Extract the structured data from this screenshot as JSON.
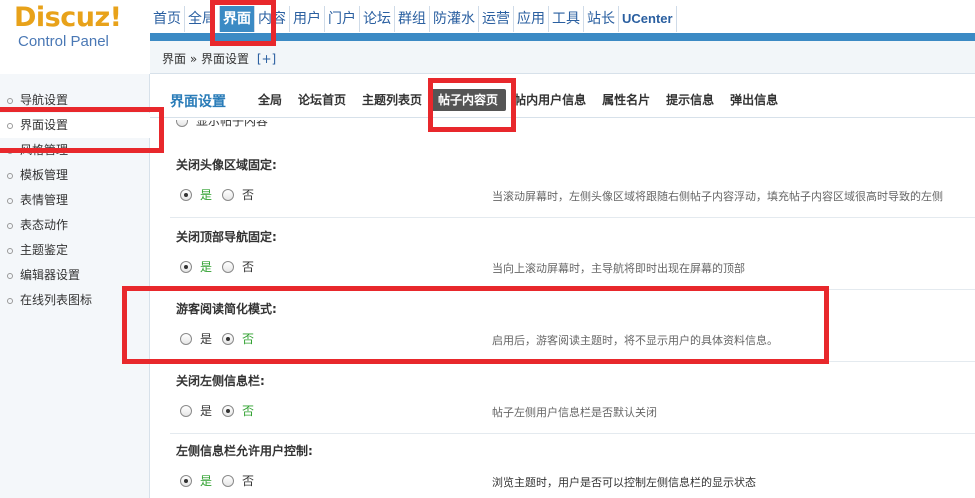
{
  "logo": {
    "brand": "Discuz!",
    "subtitle": "Control Panel"
  },
  "topnav": {
    "items": [
      {
        "label": "首页",
        "active": false
      },
      {
        "label": "全局",
        "active": false
      },
      {
        "label": "界面",
        "active": true
      },
      {
        "label": "内容",
        "active": false
      },
      {
        "label": "用户",
        "active": false
      },
      {
        "label": "门户",
        "active": false
      },
      {
        "label": "论坛",
        "active": false
      },
      {
        "label": "群组",
        "active": false
      },
      {
        "label": "防灌水",
        "active": false
      },
      {
        "label": "运营",
        "active": false
      },
      {
        "label": "应用",
        "active": false
      },
      {
        "label": "工具",
        "active": false
      },
      {
        "label": "站长",
        "active": false
      },
      {
        "label": "UCenter",
        "active": false
      }
    ]
  },
  "breadcrumb": {
    "text": "界面 » 界面设置",
    "add": "[+]"
  },
  "sidebar": {
    "items": [
      {
        "label": "导航设置"
      },
      {
        "label": "界面设置"
      },
      {
        "label": "风格管理"
      },
      {
        "label": "模板管理"
      },
      {
        "label": "表情管理"
      },
      {
        "label": "表态动作"
      },
      {
        "label": "主题鉴定"
      },
      {
        "label": "编辑器设置"
      },
      {
        "label": "在线列表图标"
      }
    ],
    "active_index": 1
  },
  "subnav": {
    "title": "界面设置",
    "tabs": [
      {
        "label": "全局"
      },
      {
        "label": "论坛首页"
      },
      {
        "label": "主题列表页"
      },
      {
        "label": "帖子内容页"
      },
      {
        "label": "帖内用户信息"
      },
      {
        "label": "属性名片"
      },
      {
        "label": "提示信息"
      },
      {
        "label": "弹出信息"
      }
    ],
    "active_index": 3
  },
  "truncated_option": "显示帖子内容",
  "settings": [
    {
      "label": "关闭头像区域固定:",
      "yes": "是",
      "no": "否",
      "selected": "yes",
      "desc": "当滚动屏幕时，左侧头像区域将跟随右侧帖子内容浮动，填充帖子内容区域很高时导致的左侧"
    },
    {
      "label": "关闭顶部导航固定:",
      "yes": "是",
      "no": "否",
      "selected": "yes",
      "desc": "当向上滚动屏幕时，主导航将即时出现在屏幕的顶部"
    },
    {
      "label": "游客阅读简化模式:",
      "yes": "是",
      "no": "否",
      "selected": "no",
      "desc": "启用后，游客阅读主题时，将不显示用户的具体资料信息。"
    },
    {
      "label": "关闭左侧信息栏:",
      "yes": "是",
      "no": "否",
      "selected": "no",
      "desc": "帖子左侧用户信息栏是否默认关闭"
    },
    {
      "label": "左侧信息栏允许用户控制:",
      "yes": "是",
      "no": "否",
      "selected": "yes",
      "desc": "浏览主题时，用户是否可以控制左侧信息栏的显示状态"
    }
  ],
  "annotation_color": "#e8282c",
  "accent_color": "#3b8ac4"
}
